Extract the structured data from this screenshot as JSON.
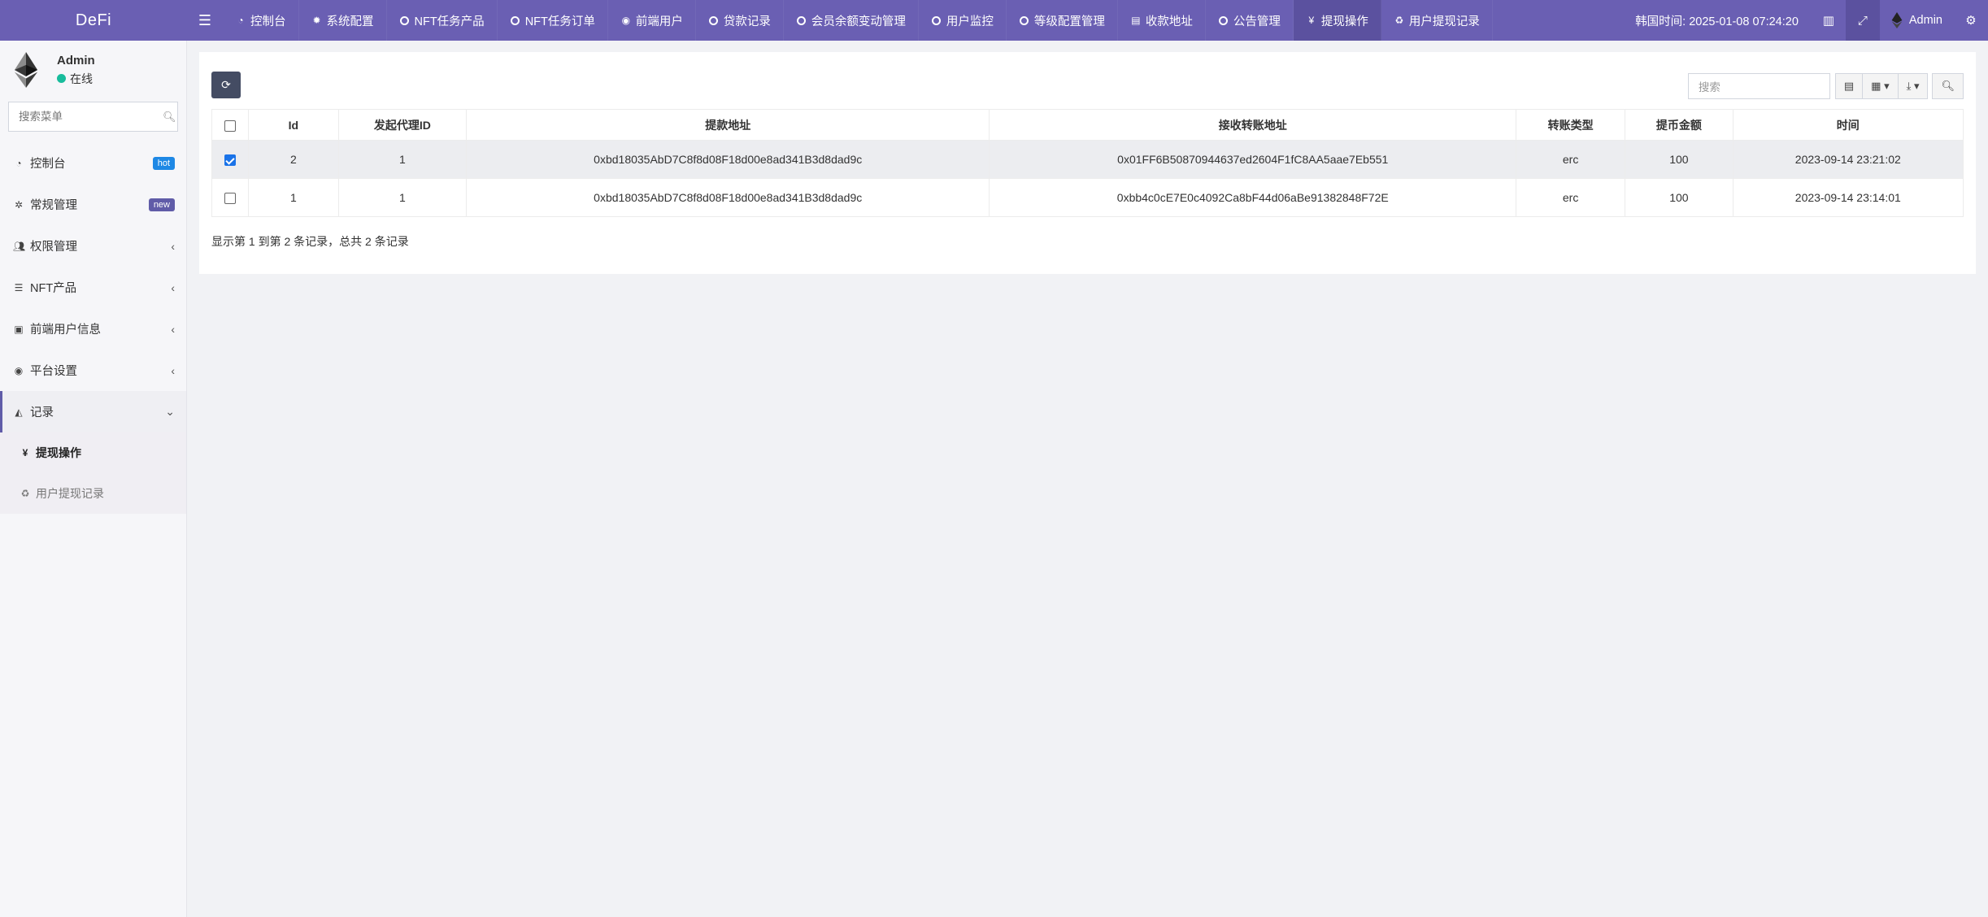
{
  "brand": "DeFi",
  "topnav": {
    "tabs": [
      {
        "label": "控制台",
        "icon": "dashboard-icon",
        "active": false
      },
      {
        "label": "系统配置",
        "icon": "gear-icon",
        "active": false
      },
      {
        "label": "NFT任务产品",
        "icon": "circle-icon",
        "active": false
      },
      {
        "label": "NFT任务订单",
        "icon": "circle-icon",
        "active": false
      },
      {
        "label": "前端用户",
        "icon": "user-circle-icon",
        "active": false
      },
      {
        "label": "贷款记录",
        "icon": "circle-icon",
        "active": false
      },
      {
        "label": "会员余额变动管理",
        "icon": "circle-icon",
        "active": false
      },
      {
        "label": "用户监控",
        "icon": "circle-icon",
        "active": false
      },
      {
        "label": "等级配置管理",
        "icon": "circle-icon",
        "active": false
      },
      {
        "label": "收款地址",
        "icon": "card-icon",
        "active": false
      },
      {
        "label": "公告管理",
        "icon": "circle-icon",
        "active": false
      },
      {
        "label": "提现操作",
        "icon": "yen-icon",
        "active": true
      },
      {
        "label": "用户提现记录",
        "icon": "recycle-icon",
        "active": false
      }
    ],
    "clock": "韩国时间: 2025-01-08 07:24:20",
    "user": "Admin"
  },
  "sidebar": {
    "user_name": "Admin",
    "user_status": "在线",
    "search_placeholder": "搜索菜单",
    "items": [
      {
        "label": "控制台",
        "icon": "dashboard-icon",
        "badge": "hot"
      },
      {
        "label": "常规管理",
        "icon": "cogs-icon",
        "badge": "new"
      },
      {
        "label": "权限管理",
        "icon": "group-icon",
        "caret": "‹"
      },
      {
        "label": "NFT产品",
        "icon": "list-icon",
        "caret": "‹"
      },
      {
        "label": "前端用户信息",
        "icon": "contact-icon",
        "caret": "‹"
      },
      {
        "label": "平台设置",
        "icon": "dot-circle-icon",
        "caret": "‹"
      },
      {
        "label": "记录",
        "icon": "area-chart-icon",
        "caret": "⌄"
      }
    ],
    "sub_items": [
      {
        "label": "提现操作",
        "icon": "yen-icon",
        "active": true
      },
      {
        "label": "用户提现记录",
        "icon": "recycle-icon",
        "active": false
      }
    ]
  },
  "toolbar": {
    "search_placeholder": "搜索"
  },
  "table": {
    "columns": [
      "Id",
      "发起代理ID",
      "提款地址",
      "接收转账地址",
      "转账类型",
      "提币金额",
      "时间"
    ],
    "rows": [
      {
        "checked": true,
        "cells": [
          "2",
          "1",
          "0xbd18035AbD7C8f8d08F18d00e8ad341B3d8dad9c",
          "0x01FF6B50870944637ed2604F1fC8AA5aae7Eb551",
          "erc",
          "100",
          "2023-09-14 23:21:02"
        ]
      },
      {
        "checked": false,
        "cells": [
          "1",
          "1",
          "0xbd18035AbD7C8f8d08F18d00e8ad341B3d8dad9c",
          "0xbb4c0cE7E0c4092Ca8bF44d06aBe91382848F72E",
          "erc",
          "100",
          "2023-09-14 23:14:01"
        ]
      }
    ]
  },
  "pagination_info": "显示第 1 到第 2 条记录，总共 2 条记录"
}
